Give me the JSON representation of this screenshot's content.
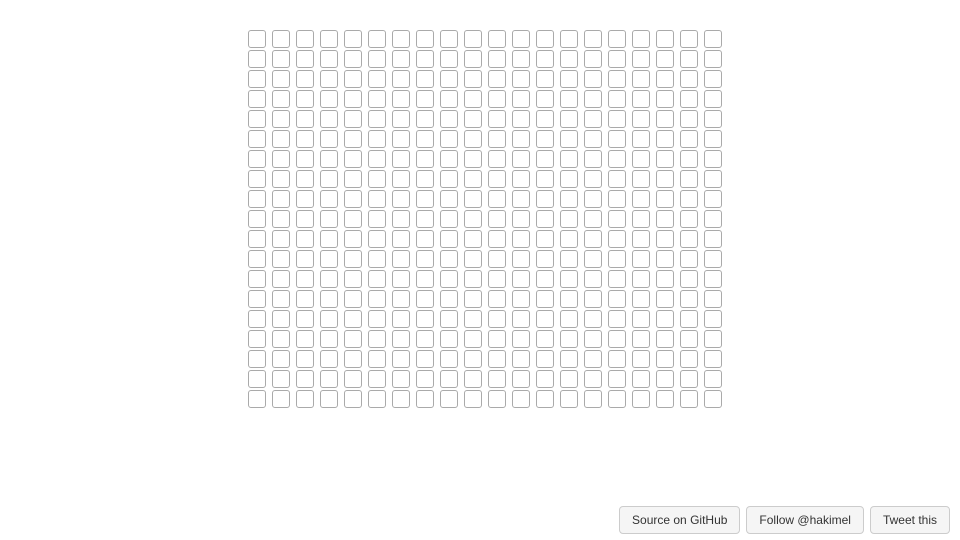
{
  "grid": {
    "rows": 19,
    "cols": 20
  },
  "buttons": {
    "github": "Source on GitHub",
    "follow": "Follow @hakimel",
    "tweet": "Tweet this"
  }
}
